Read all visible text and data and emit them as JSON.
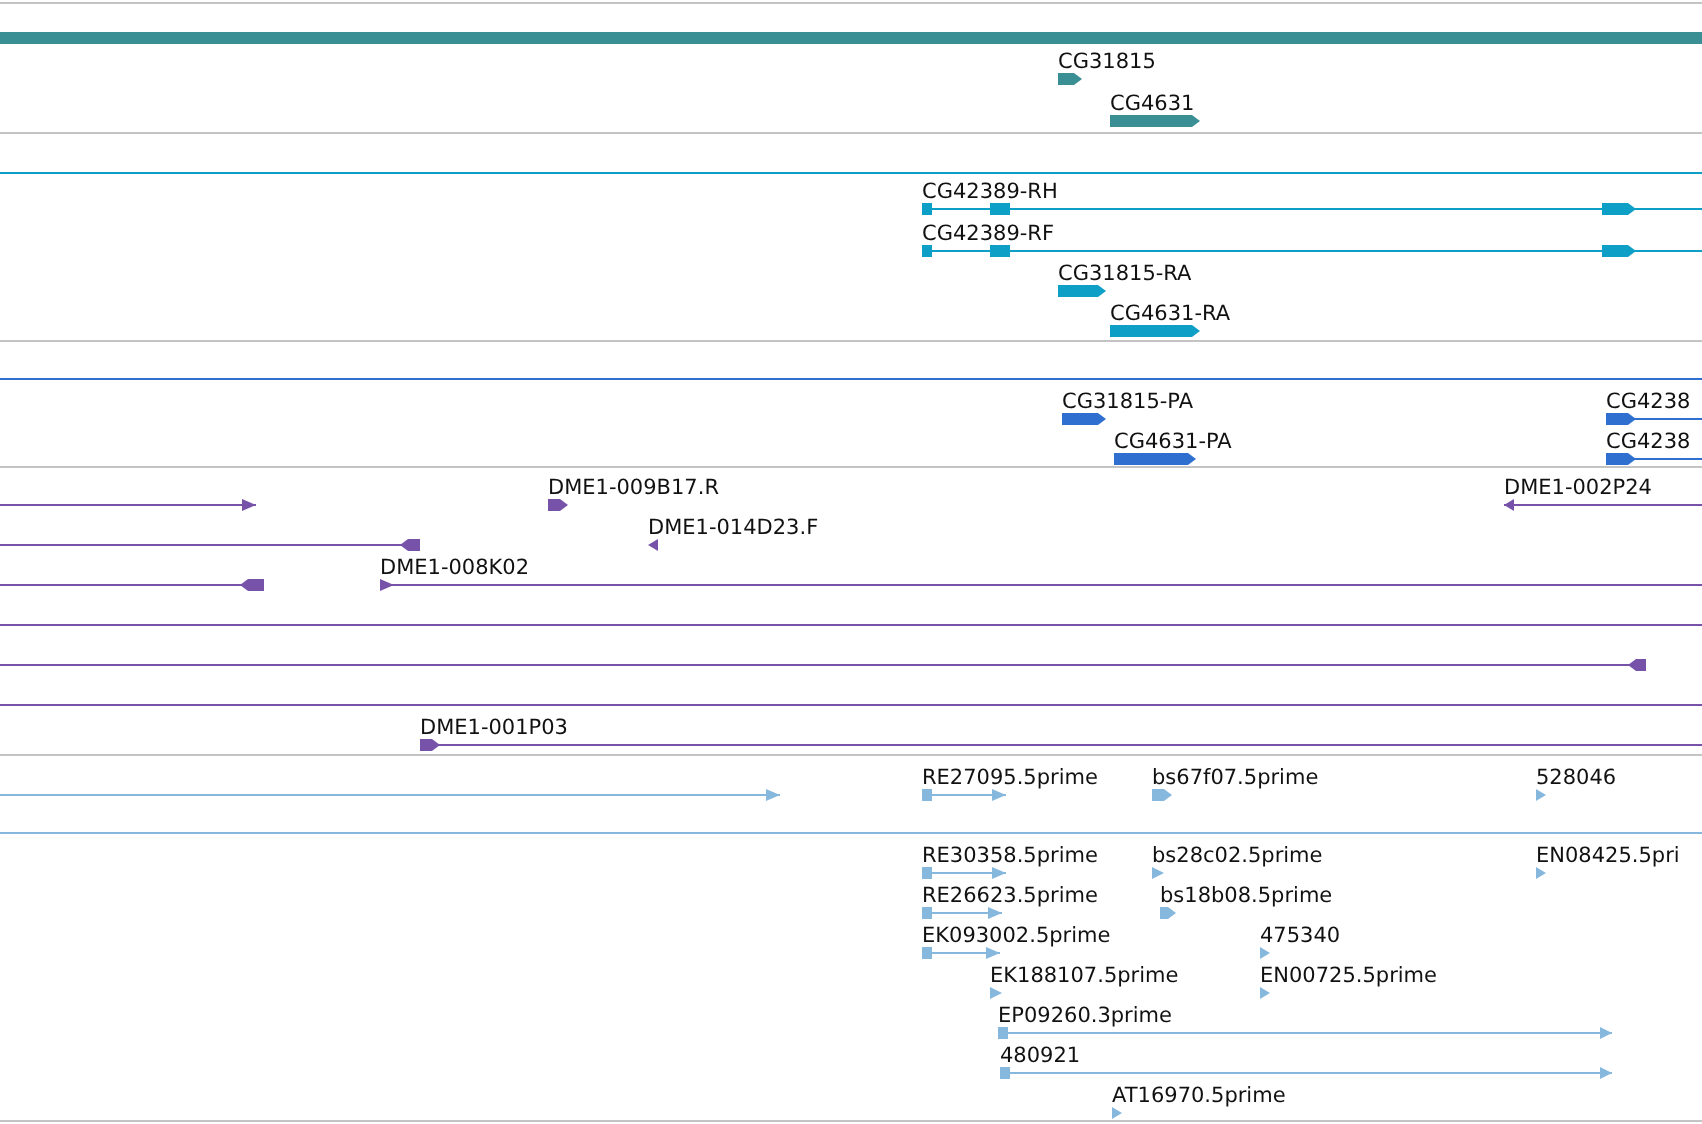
{
  "tracks": [
    {
      "color": "#3a8f94",
      "features": [
        {
          "kind": "bar"
        },
        {
          "kind": "gene",
          "label": "CG31815",
          "reverse": false
        },
        {
          "kind": "gene",
          "label": "CG4631",
          "reverse": false
        }
      ]
    },
    {
      "color": "#0e9fc6",
      "features": [
        {
          "kind": "span"
        },
        {
          "kind": "gene",
          "label": "CG42389-RH",
          "reverse": false
        },
        {
          "kind": "gene",
          "label": "CG42389-RF",
          "reverse": false
        },
        {
          "kind": "gene",
          "label": "CG31815-RA",
          "reverse": false
        },
        {
          "kind": "gene",
          "label": "CG4631-RA",
          "reverse": false
        }
      ]
    },
    {
      "color": "#2e6fd0",
      "features": [
        {
          "kind": "span"
        },
        {
          "kind": "gene",
          "label": "CG31815-PA",
          "reverse": false
        },
        {
          "kind": "gene",
          "label": "CG4631-PA",
          "reverse": false
        },
        {
          "kind": "gene",
          "label": "CG4238",
          "reverse": false
        },
        {
          "kind": "gene",
          "label": "CG4238",
          "reverse": false
        }
      ]
    },
    {
      "color": "#7653a8",
      "features": [
        {
          "kind": "gene",
          "reverse": false
        },
        {
          "kind": "gene",
          "label": "DME1-009B17.R",
          "reverse": false
        },
        {
          "kind": "gene",
          "label": "DME1-002P24",
          "reverse": true
        },
        {
          "kind": "gene",
          "reverse": true
        },
        {
          "kind": "gene",
          "label": "DME1-014D23.F",
          "reverse": true
        },
        {
          "kind": "gene",
          "reverse": true
        },
        {
          "kind": "gene",
          "label": "DME1-008K02",
          "reverse": false
        },
        {
          "kind": "span"
        },
        {
          "kind": "gene",
          "reverse": true
        },
        {
          "kind": "span"
        },
        {
          "kind": "gene",
          "label": "DME1-001P03",
          "reverse": false
        }
      ]
    },
    {
      "color": "#86b8de",
      "features": [
        {
          "kind": "gene",
          "reverse": false
        },
        {
          "kind": "gene",
          "label": "RE27095.5prime",
          "reverse": false
        },
        {
          "kind": "gene",
          "label": "bs67f07.5prime",
          "reverse": false
        },
        {
          "kind": "gene",
          "label": "528046",
          "reverse": false
        },
        {
          "kind": "span"
        },
        {
          "kind": "gene",
          "label": "RE30358.5prime",
          "reverse": false
        },
        {
          "kind": "gene",
          "label": "bs28c02.5prime",
          "reverse": false
        },
        {
          "kind": "gene",
          "label": "EN08425.5pri",
          "reverse": false
        },
        {
          "kind": "gene",
          "label": "RE26623.5prime",
          "reverse": false
        },
        {
          "kind": "gene",
          "label": "bs18b08.5prime",
          "reverse": false
        },
        {
          "kind": "gene",
          "label": "EK093002.5prime",
          "reverse": false
        },
        {
          "kind": "gene",
          "label": "475340",
          "reverse": false
        },
        {
          "kind": "gene",
          "label": "EK188107.5prime",
          "reverse": false
        },
        {
          "kind": "gene",
          "label": "EN00725.5prime",
          "reverse": false
        },
        {
          "kind": "gene",
          "label": "EP09260.3prime",
          "reverse": false
        },
        {
          "kind": "gene",
          "label": "480921",
          "reverse": false
        },
        {
          "kind": "gene",
          "label": "AT16970.5prime",
          "reverse": false
        }
      ]
    }
  ]
}
